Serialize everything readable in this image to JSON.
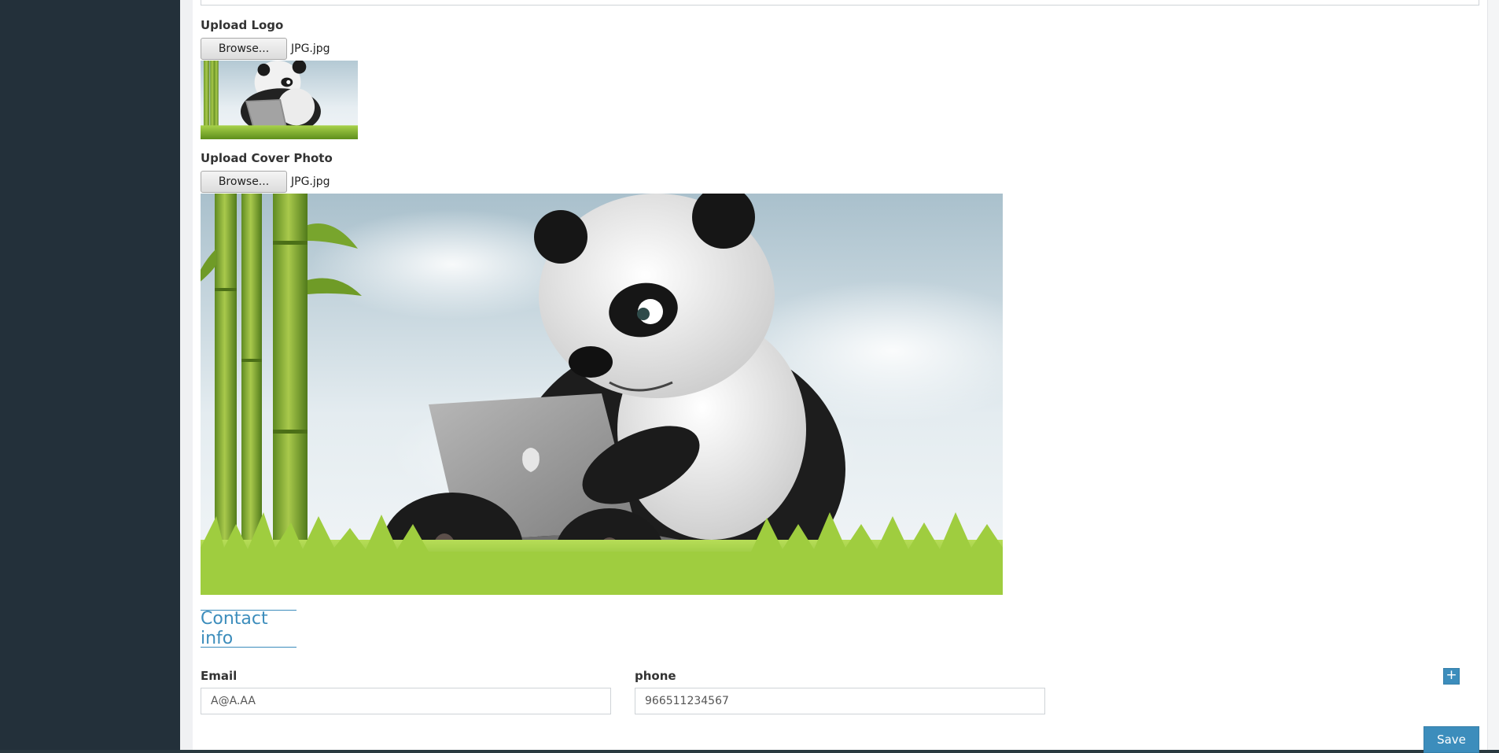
{
  "form": {
    "upload_logo": {
      "label": "Upload Logo",
      "browse_label": "Browse...",
      "file_name": "JPG.jpg"
    },
    "upload_cover": {
      "label": "Upload Cover Photo",
      "browse_label": "Browse...",
      "file_name": "JPG.jpg"
    },
    "contact": {
      "section_title": "Contact info",
      "email_label": "Email",
      "email_value": "A@A.AA",
      "phone_label": "phone",
      "phone_value": "966511234567",
      "add_label": "+"
    },
    "save_label": "Save"
  },
  "colors": {
    "sidebar": "#23303a",
    "accent": "#3c8dbc"
  }
}
